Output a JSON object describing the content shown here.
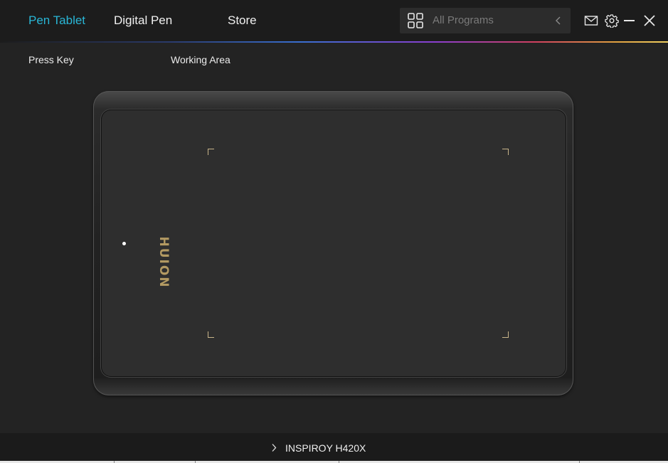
{
  "header": {
    "tabs": [
      {
        "label": "Pen Tablet",
        "active": true
      },
      {
        "label": "Digital Pen",
        "active": false
      },
      {
        "label": "Store",
        "active": false
      }
    ],
    "search": {
      "placeholder": "All Programs",
      "icon": "grid-icon",
      "back_icon": "chevron-left-icon"
    },
    "icons": [
      "mail-icon",
      "gear-icon",
      "minimize-icon",
      "close-icon"
    ]
  },
  "subnav": {
    "items": [
      "Press Key",
      "Working Area"
    ]
  },
  "tablet": {
    "brand": "HUION",
    "corner_marks": [
      "top-left",
      "top-right",
      "bottom-left",
      "bottom-right"
    ]
  },
  "footer": {
    "device_name": "INSPIROY H420X"
  },
  "colors": {
    "accent": "#29b6d6",
    "background": "#232323",
    "brand_gold": "#b39a62"
  }
}
